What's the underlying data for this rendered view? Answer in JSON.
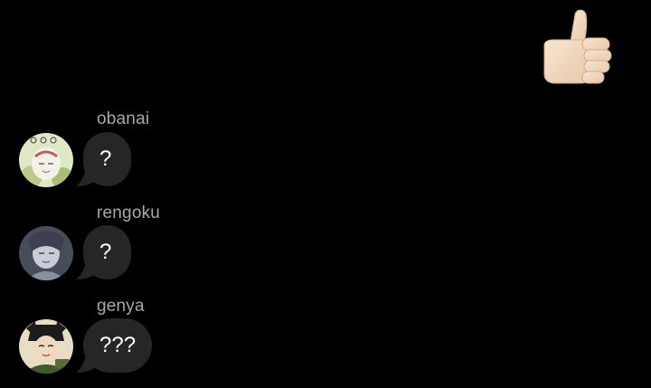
{
  "thread": {
    "sent_reaction": {
      "icon": "thumbs-up-icon",
      "skin_color": "#f3dcc3",
      "shadow_color": "#d9b999"
    },
    "messages": [
      {
        "sender": "obanai",
        "text": "?",
        "avatar_icon": "obanai-avatar-icon"
      },
      {
        "sender": "rengoku",
        "text": "?",
        "avatar_icon": "rengoku-avatar-icon"
      },
      {
        "sender": "genya",
        "text": "???",
        "avatar_icon": "genya-avatar-icon"
      }
    ],
    "colors": {
      "background": "#000000",
      "bubble": "#262626",
      "sender_name": "#a8a8a8",
      "message_text": "#ffffff"
    }
  }
}
